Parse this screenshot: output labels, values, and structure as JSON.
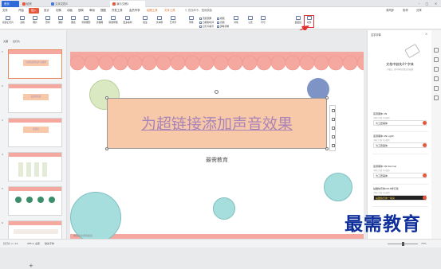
{
  "titlebar": {
    "tabs": [
      {
        "label": "首页"
      },
      {
        "label": "稻壳"
      },
      {
        "label": "文本文档3"
      },
      {
        "label": "演示文稿1"
      }
    ]
  },
  "menubar": {
    "items": [
      "文件",
      "开始",
      "插入",
      "设计",
      "切换",
      "动画",
      "放映",
      "审阅",
      "视图",
      "开发工具",
      "会员专享",
      "绘图工具",
      "文本工具",
      "查找命令、搜索模板"
    ],
    "active_index": 2,
    "right_items": [
      "未同步",
      "协作",
      "分享"
    ]
  },
  "ribbon": {
    "buttons": [
      "新建幻灯片",
      "表格",
      "图片",
      "形状",
      "图标",
      "图表",
      "智能图形",
      "流程图",
      "思维导图",
      "更多素材",
      "批注",
      "文本框",
      "艺术字",
      "附件",
      "对象",
      "公式",
      "符号",
      "超链接",
      "动作"
    ],
    "small": [
      "页眉页脚",
      "日期和时间",
      "幻灯片编号",
      "视频",
      "音频",
      "屏幕录制"
    ]
  },
  "leftpanel": {
    "tabs": [
      "大纲",
      "幻灯片"
    ],
    "thumb_titles": [
      "为超链接添加声音效果",
      "设置超链接",
      "超链接",
      "",
      "",
      ""
    ],
    "add_label": "+"
  },
  "slide": {
    "title": "为超链接添加声音效果",
    "subtitle": "最需教育",
    "notes_placeholder": "单击此处添加备注"
  },
  "rightpanel": {
    "header": "文字字体",
    "banner_title": "文档中缺失4个字体",
    "banner_sub": "下载后，即可体验完整文档效果",
    "cards": [
      {
        "name": "思源黑体 CN",
        "sub": "字体已下载 可以使用",
        "preview": "为工匠美体"
      },
      {
        "name": "思源黑体 CN Light",
        "sub": "字体已下载 可以使用",
        "preview": "为工匠美体"
      },
      {
        "name": "思源黑体 CN Normal",
        "sub": "字体已下载 可以使用",
        "preview": "为工匠美体"
      },
      {
        "name": "站酷快乐体2016修订版",
        "sub": "字体已下载 可以使用",
        "preview": "站酷快乐体一等奖"
      }
    ]
  },
  "statusbar": {
    "page": "幻灯片 1 / 21",
    "theme": "Office 主题",
    "missing": "缺失字体",
    "notes": "单击此处添加备注",
    "zoom": "75%"
  },
  "watermark": "最需教育",
  "colors": {
    "accent": "#e6583b",
    "slide_pink": "#f4a8a0",
    "title_box": "#f8c9a8",
    "title_text": "#a884b8"
  }
}
